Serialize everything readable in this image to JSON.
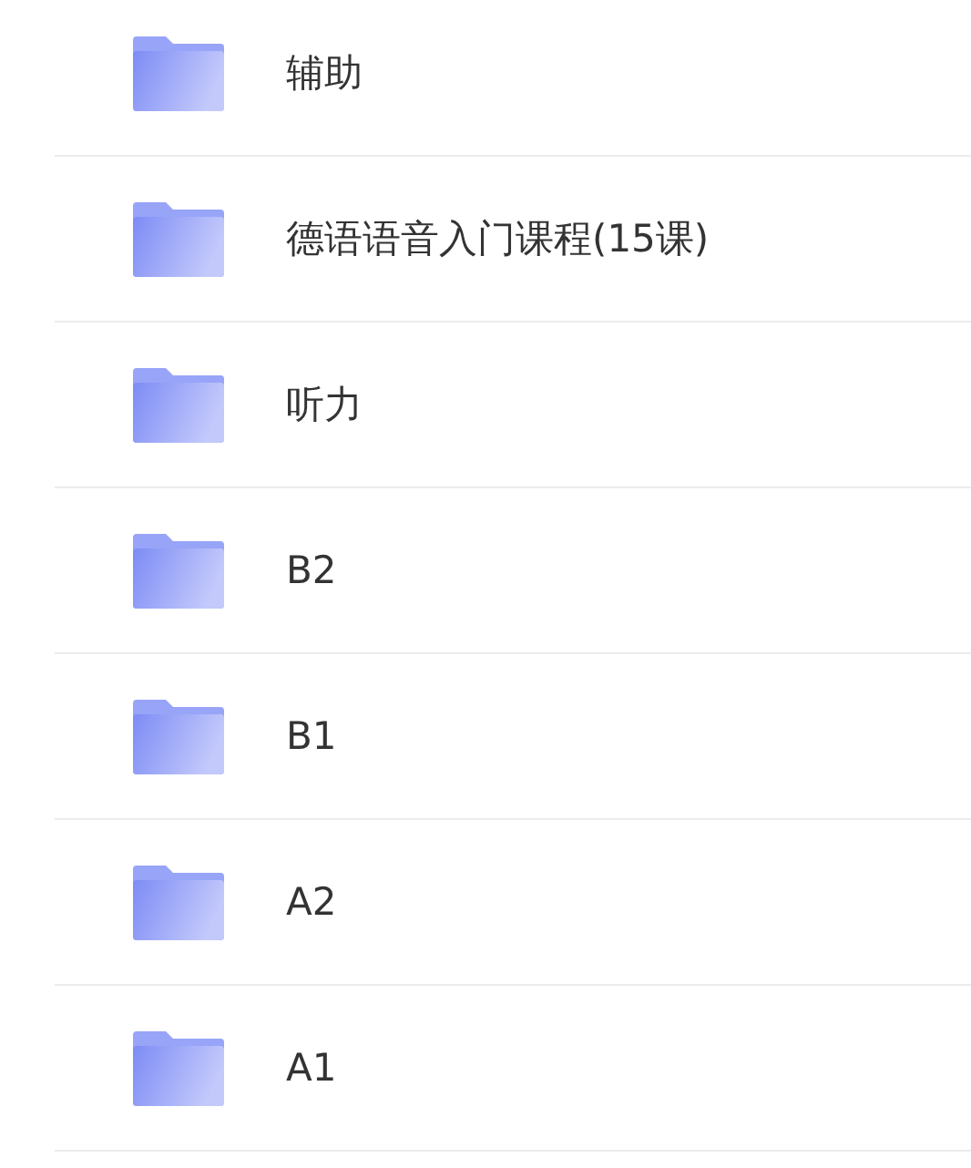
{
  "folders": [
    {
      "name": "辅助"
    },
    {
      "name": "德语语音入门课程(15课)"
    },
    {
      "name": "听力"
    },
    {
      "name": "B2"
    },
    {
      "name": "B1"
    },
    {
      "name": "A2"
    },
    {
      "name": "A1"
    }
  ]
}
